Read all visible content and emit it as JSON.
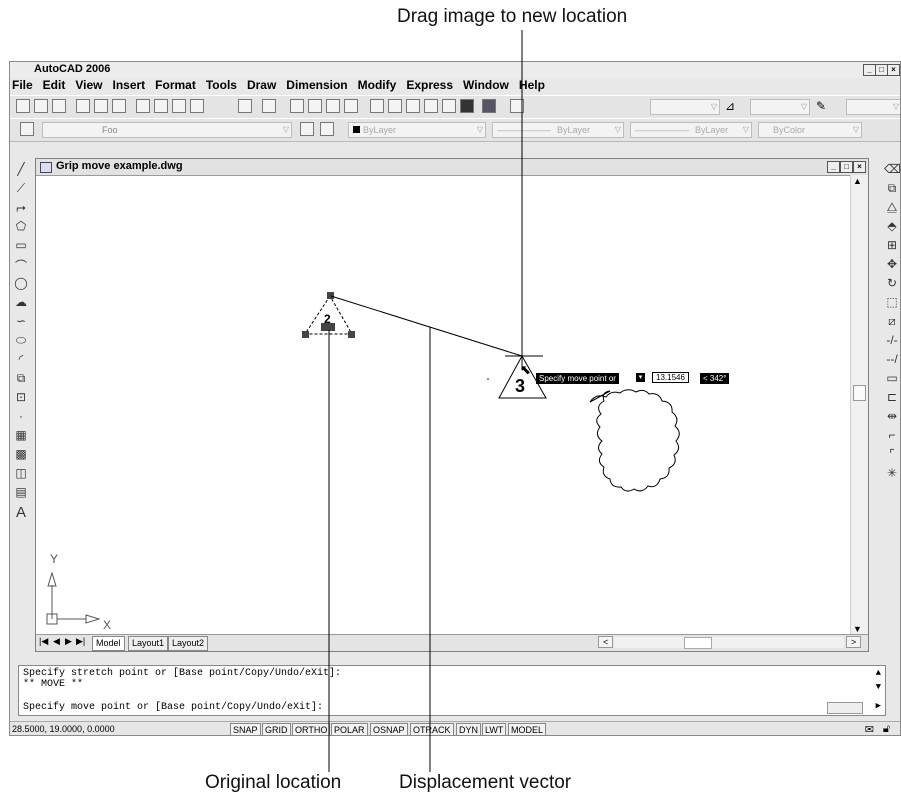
{
  "callouts": {
    "drag": "Drag image to new location",
    "original": "Original location",
    "vector": "Displacement vector"
  },
  "app": {
    "title": "AutoCAD 2006",
    "menu": [
      "File",
      "Edit",
      "View",
      "Insert",
      "Format",
      "Tools",
      "Draw",
      "Dimension",
      "Modify",
      "Express",
      "Window",
      "Help"
    ],
    "layer_combo": "Foo",
    "color_combo": "ByLayer",
    "linetype_combo": "ByLayer",
    "lineweight_combo": "ByLayer",
    "plotstyle_combo": "ByColor"
  },
  "drawing": {
    "title": "Grip move example.dwg",
    "label_original": "2",
    "label_new": "3",
    "ucs_x": "X",
    "ucs_y": "Y",
    "tooltip_prompt": "Specify move point or",
    "tooltip_value": "13.1546",
    "tooltip_angle": "< 342°"
  },
  "tabs": [
    "Model",
    "Layout1",
    "Layout2"
  ],
  "command": {
    "line1": "Specify stretch point or [Base point/Copy/Undo/eXit]:",
    "line2": "** MOVE **",
    "line3": "Specify move point or [Base point/Copy/Undo/eXit]:"
  },
  "status": {
    "coords": "28.5000, 19.0000, 0.0000",
    "buttons": [
      "SNAP",
      "GRID",
      "ORTHO",
      "POLAR",
      "OSNAP",
      "OTRACK",
      "DYN",
      "LWT",
      "MODEL"
    ]
  },
  "icons": [
    "pencil-icon",
    "lock-icon"
  ]
}
